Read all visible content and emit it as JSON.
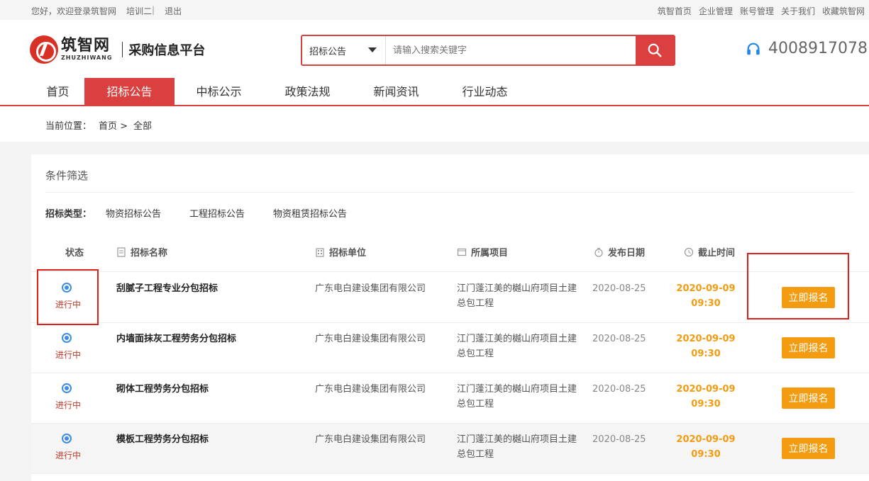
{
  "topbar": {
    "welcome": "您好，欢迎登录筑智网",
    "user": "培训二",
    "separator": "|",
    "logout": "退出",
    "links": [
      "筑智首页",
      "企业管理",
      "账号管理",
      "关于我们",
      "收藏筑智网"
    ]
  },
  "header": {
    "logo_cn": "筑智网",
    "logo_en": "ZHUZHIWANG",
    "platform": "采购信息平台",
    "search_category": "招标公告",
    "search_placeholder": "请输入搜索关键字",
    "hotline": "4008917078"
  },
  "nav": {
    "items": [
      "首页",
      "招标公告",
      "中标公示",
      "政策法规",
      "新闻资讯",
      "行业动态"
    ],
    "active": "招标公告"
  },
  "breadcrumb": {
    "label": "当前位置：",
    "home": "首页 >",
    "current": "全部"
  },
  "filters": {
    "title": "条件筛选",
    "type_label": "招标类型：",
    "options": [
      "物资招标公告",
      "工程招标公告",
      "物资租赁招标公告"
    ]
  },
  "table": {
    "columns": {
      "status": "状态",
      "name": "招标名称",
      "unit": "招标单位",
      "project": "所属项目",
      "publish_date": "发布日期",
      "deadline": "截止时间"
    },
    "rows": [
      {
        "status": "进行中",
        "name": "刮腻子工程专业分包招标",
        "unit": "广东电白建设集团有限公司",
        "project": "江门蓬江美的樾山府项目土建总包工程",
        "publish_date": "2020-08-25",
        "deadline_date": "2020-09-09",
        "deadline_time": "09:30",
        "action": "立即报名"
      },
      {
        "status": "进行中",
        "name": "内墙面抹灰工程劳务分包招标",
        "unit": "广东电白建设集团有限公司",
        "project": "江门蓬江美的樾山府项目土建总包工程",
        "publish_date": "2020-08-25",
        "deadline_date": "2020-09-09",
        "deadline_time": "09:30",
        "action": "立即报名"
      },
      {
        "status": "进行中",
        "name": "砌体工程劳务分包招标",
        "unit": "广东电白建设集团有限公司",
        "project": "江门蓬江美的樾山府项目土建总包工程",
        "publish_date": "2020-08-25",
        "deadline_date": "2020-09-09",
        "deadline_time": "09:30",
        "action": "立即报名"
      },
      {
        "status": "进行中",
        "name": "模板工程劳务分包招标",
        "unit": "广东电白建设集团有限公司",
        "project": "江门蓬江美的樾山府项目土建总包工程",
        "publish_date": "2020-08-25",
        "deadline_date": "2020-09-09",
        "deadline_time": "09:30",
        "action": "立即报名"
      }
    ]
  },
  "colors": {
    "brand_red": "#d9403f",
    "accent_orange": "#f39c12",
    "status_blue": "#3d8ce8",
    "status_text_red": "#c0392b",
    "highlight_red": "#e0201a"
  },
  "icons": {
    "search": "search-icon",
    "hotline": "headset-icon",
    "name_col": "document-icon",
    "unit_col": "building-icon",
    "project_col": "folder-icon",
    "publish_col": "stopwatch-icon",
    "deadline_col": "clock-icon"
  }
}
